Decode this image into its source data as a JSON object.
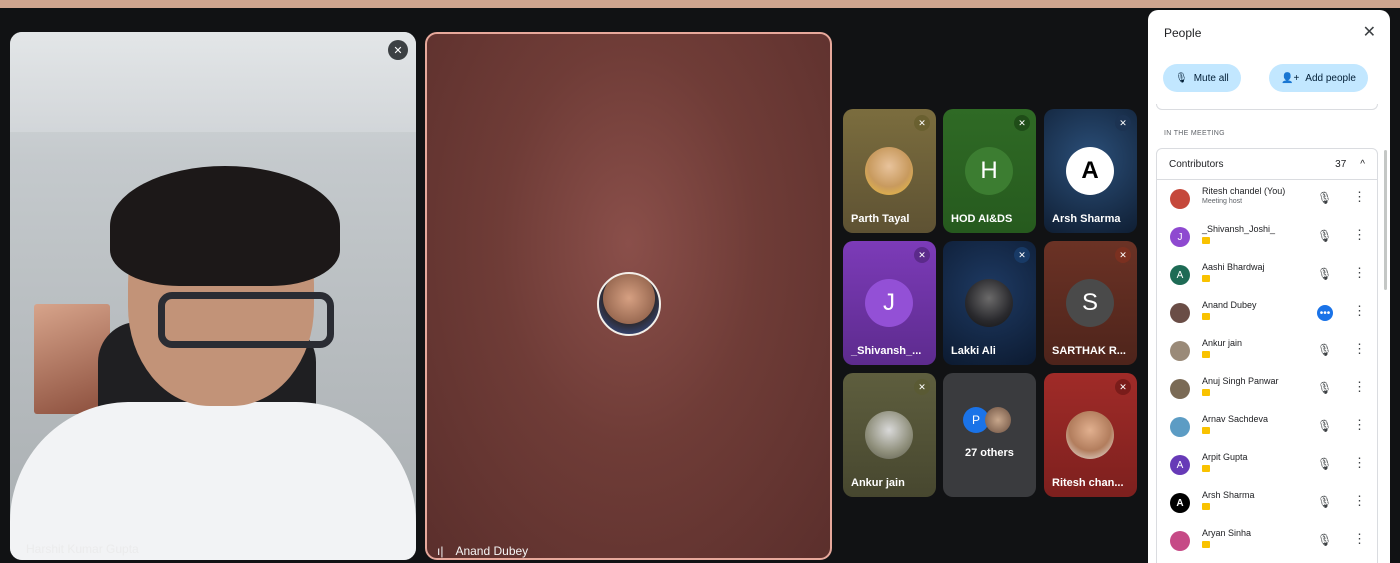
{
  "main_tile": {
    "name": "Harshit Kumar Gupta"
  },
  "speaker_tile": {
    "name": "Anand Dubey"
  },
  "grid": [
    {
      "label": "Parth Tayal"
    },
    {
      "label": "HOD AI&DS",
      "initial": "H"
    },
    {
      "label": "Arsh Sharma",
      "initial": "A"
    },
    {
      "label": "_Shivansh_...",
      "initial": "J"
    },
    {
      "label": "Lakki Ali"
    },
    {
      "label": "SARTHAK R...",
      "initial": "S"
    },
    {
      "label": "Ankur jain"
    },
    {
      "label": "27 others",
      "initial": "P"
    },
    {
      "label": "Ritesh chan..."
    }
  ],
  "panel": {
    "title": "People",
    "mute_all": "Mute all",
    "add_people": "Add people",
    "section": "IN THE MEETING",
    "contributors_label": "Contributors",
    "contributors_count": "37",
    "people": [
      {
        "name": "Ritesh chandel (You)",
        "sub": "Meeting host",
        "initial": "",
        "color": "#c5483b"
      },
      {
        "name": "_Shivansh_Joshi_",
        "initial": "J",
        "color": "#8e49d0"
      },
      {
        "name": "Aashi Bhardwaj",
        "initial": "A",
        "color": "#1e6b55"
      },
      {
        "name": "Anand Dubey",
        "initial": "",
        "color": "#6a4d46"
      },
      {
        "name": "Ankur jain",
        "initial": "",
        "color": "#9a8a78"
      },
      {
        "name": "Anuj Singh Panwar",
        "initial": "",
        "color": "#7a6a55"
      },
      {
        "name": "Arnav Sachdeva",
        "initial": "",
        "color": "#5c9cc4"
      },
      {
        "name": "Arpit Gupta",
        "initial": "A",
        "color": "#673ab7"
      },
      {
        "name": "Arsh Sharma",
        "initial": "A",
        "color": "#000000"
      },
      {
        "name": "Aryan Sinha",
        "initial": "",
        "color": "#c64a86"
      }
    ]
  }
}
